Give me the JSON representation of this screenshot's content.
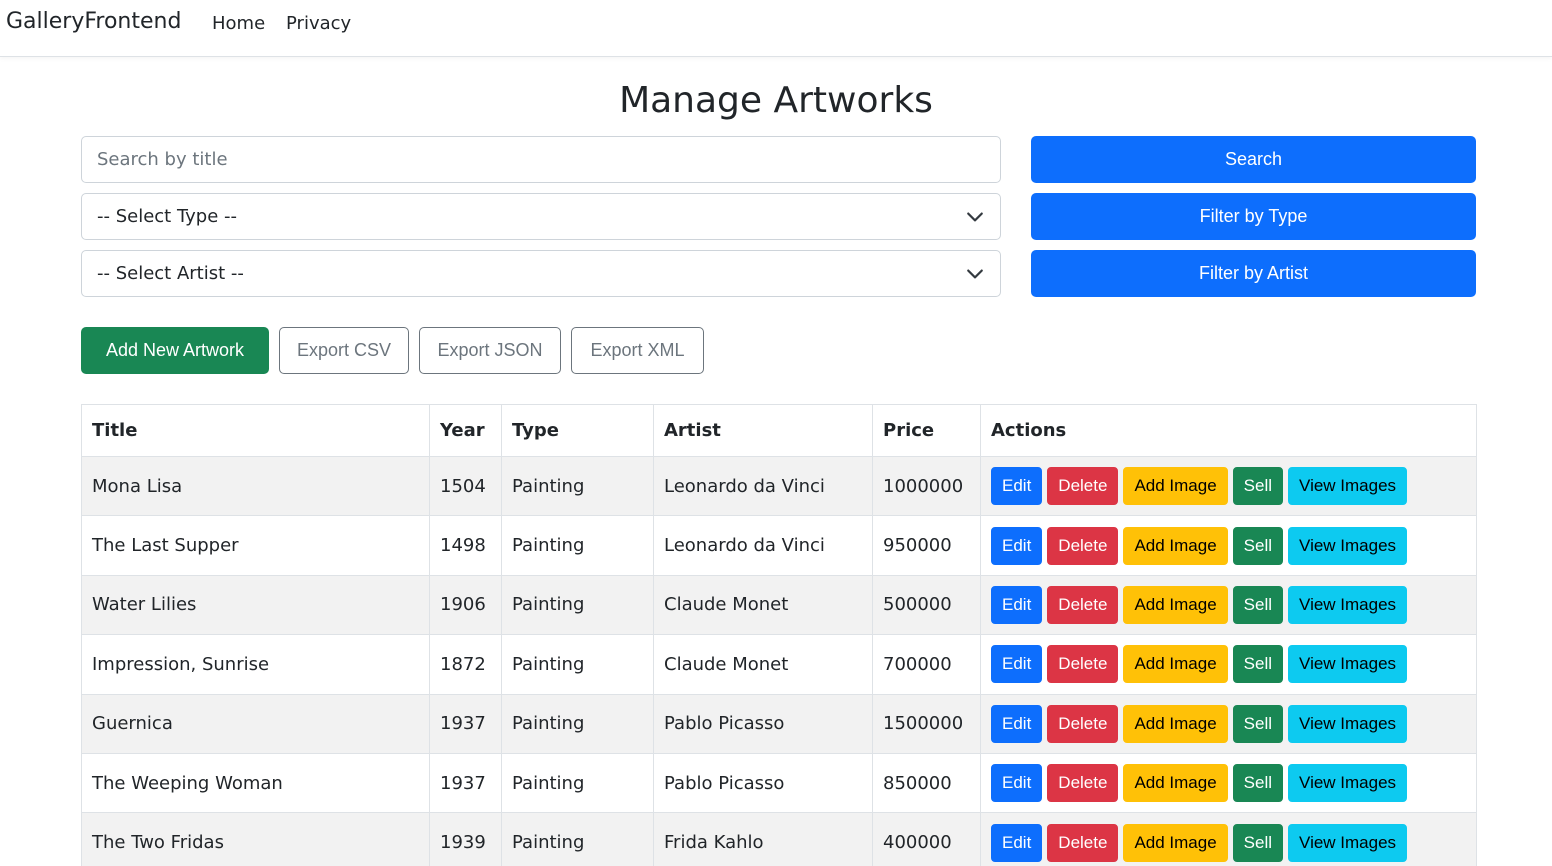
{
  "navbar": {
    "brand": "GalleryFrontend",
    "links": [
      "Home",
      "Privacy"
    ]
  },
  "page": {
    "title": "Manage Artworks"
  },
  "filters": {
    "search_placeholder": "Search by title",
    "search_value": "",
    "type_select": "-- Select Type --",
    "artist_select": "-- Select Artist --",
    "search_button": "Search",
    "filter_type_button": "Filter by Type",
    "filter_artist_button": "Filter by Artist"
  },
  "toolbar": {
    "add_button": "Add New Artwork",
    "export_csv": "Export CSV",
    "export_json": "Export JSON",
    "export_xml": "Export XML"
  },
  "table": {
    "headers": [
      "Title",
      "Year",
      "Type",
      "Artist",
      "Price",
      "Actions"
    ],
    "action_labels": {
      "edit": "Edit",
      "delete": "Delete",
      "add_image": "Add Image",
      "sell": "Sell",
      "view_images": "View Images"
    },
    "rows": [
      {
        "title": "Mona Lisa",
        "year": "1504",
        "type": "Painting",
        "artist": "Leonardo da Vinci",
        "price": "1000000"
      },
      {
        "title": "The Last Supper",
        "year": "1498",
        "type": "Painting",
        "artist": "Leonardo da Vinci",
        "price": "950000"
      },
      {
        "title": "Water Lilies",
        "year": "1906",
        "type": "Painting",
        "artist": "Claude Monet",
        "price": "500000"
      },
      {
        "title": "Impression, Sunrise",
        "year": "1872",
        "type": "Painting",
        "artist": "Claude Monet",
        "price": "700000"
      },
      {
        "title": "Guernica",
        "year": "1937",
        "type": "Painting",
        "artist": "Pablo Picasso",
        "price": "1500000"
      },
      {
        "title": "The Weeping Woman",
        "year": "1937",
        "type": "Painting",
        "artist": "Pablo Picasso",
        "price": "850000"
      },
      {
        "title": "The Two Fridas",
        "year": "1939",
        "type": "Painting",
        "artist": "Frida Kahlo",
        "price": "400000"
      }
    ]
  },
  "colors": {
    "primary": "#0d6efd",
    "success": "#198754",
    "danger": "#dc3545",
    "warning": "#ffc107",
    "info": "#0dcaf0"
  },
  "icons": {
    "select_chevron": "chevron-down-icon"
  }
}
